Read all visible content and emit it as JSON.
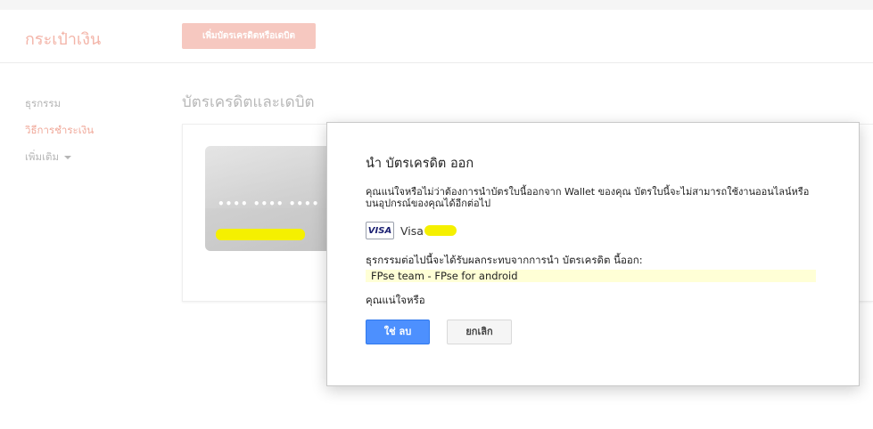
{
  "header": {
    "brand": "กระเป๋าเงิน",
    "add_button_label": "เพิ่มบัตรเครดิตหรือเดบิต"
  },
  "nav": {
    "items": [
      {
        "label": "ธุรกรรม"
      },
      {
        "label": "วิธีการชำระเงิน"
      },
      {
        "label": "เพิ่มเติม"
      }
    ]
  },
  "main": {
    "section_title": "บัตรเครดิตและเดบิต",
    "card": {
      "number_mask": "•••• •••• ••••  "
    }
  },
  "dialog": {
    "title": "นำ บัตรเครดิต ออก",
    "message": "คุณแน่ใจหรือไม่ว่าต้องการนำบัตรใบนี้ออกจาก Wallet ของคุณ บัตรใบนี้จะไม่สามารถใช้งานออนไลน์หรือบนอุปกรณ์ของคุณได้อีกต่อไป",
    "card_brand_logo": "VISA",
    "card_label": "Visa",
    "affected_label": "ธุรกรรมต่อไปนี้จะได้รับผลกระทบจากการนำ บัตรเครดิต นี้ออก:",
    "affected_item": "FPse team - FPse for android",
    "confirm_question": "คุณแน่ใจหรือ",
    "yes_button": "ใช่ ลบ",
    "cancel_button": "ยกเลิก"
  },
  "colors": {
    "brand": "#f3b4a8",
    "primary_button": "#4d90fe",
    "highlight": "#ffffd6",
    "redaction": "#f5f000"
  }
}
